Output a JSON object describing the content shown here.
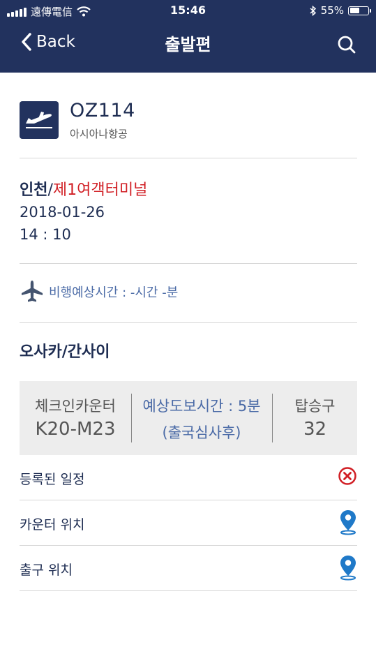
{
  "status_bar": {
    "carrier": "遠傳電信",
    "time": "15:46",
    "battery": "55%",
    "battery_level": 0.55
  },
  "nav": {
    "back_label": "Back",
    "title": "출발편"
  },
  "flight": {
    "number": "OZ114",
    "airline": "아시아나항공"
  },
  "departure": {
    "city": "인천",
    "separator": "/",
    "terminal": "제1여객터미널",
    "date": "2018-01-26",
    "time": "14 : 10"
  },
  "flight_time": {
    "text": "비행예상시간 : -시간 -분"
  },
  "arrival": {
    "city": "오사카/간사이"
  },
  "info": {
    "checkin_label": "체크인카운터",
    "checkin_value": "K20-M23",
    "walk_label": "예상도보시간 : 5분",
    "walk_sub": "(출국심사후)",
    "gate_label": "탑승구",
    "gate_value": "32"
  },
  "rows": [
    {
      "label": "등록된 일정",
      "icon": "remove-circle-icon"
    },
    {
      "label": "카운터 위치",
      "icon": "location-pin-icon"
    },
    {
      "label": "출구 위치",
      "icon": "location-pin-icon"
    }
  ],
  "colors": {
    "header": "#22325e",
    "accent_red": "#d11f25",
    "accent_blue": "#4a6aa6",
    "pin_blue": "#1f79c8"
  }
}
